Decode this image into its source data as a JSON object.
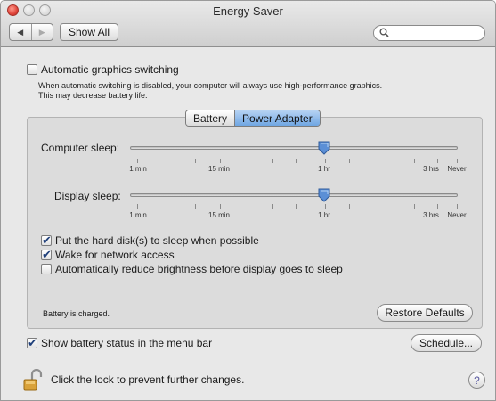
{
  "window": {
    "title": "Energy Saver",
    "show_all_label": "Show All",
    "search_placeholder": "",
    "back_glyph": "◀",
    "forward_glyph": "▶"
  },
  "graphics_switching": {
    "label": "Automatic graphics switching",
    "checked": false,
    "description_line1": "When automatic switching is disabled, your computer will always use high-performance graphics.",
    "description_line2": "This may decrease battery life."
  },
  "tabs": [
    {
      "label": "Battery",
      "active": false
    },
    {
      "label": "Power Adapter",
      "active": true
    }
  ],
  "sliders": {
    "computer_sleep": {
      "label": "Computer sleep:",
      "value": "1 hr",
      "scale_labels": [
        "1 min",
        "15 min",
        "1 hr",
        "3 hrs",
        "Never"
      ]
    },
    "display_sleep": {
      "label": "Display sleep:",
      "value": "1 hr",
      "scale_labels": [
        "1 min",
        "15 min",
        "1 hr",
        "3 hrs",
        "Never"
      ]
    }
  },
  "options": [
    {
      "label": "Put the hard disk(s) to sleep when possible",
      "checked": true
    },
    {
      "label": "Wake for network access",
      "checked": true
    },
    {
      "label": "Automatically reduce brightness before display goes to sleep",
      "checked": false
    }
  ],
  "battery_status": "Battery is charged.",
  "restore_defaults_label": "Restore Defaults",
  "show_battery_status": {
    "label": "Show battery status in the menu bar",
    "checked": true
  },
  "schedule_label": "Schedule...",
  "lock_text": "Click the lock to prevent further changes.",
  "help_glyph": "?",
  "icons": {
    "search": "search-icon",
    "lock": "lock-open-icon",
    "help": "help-icon",
    "slider_thumb": "slider-thumb-icon"
  },
  "colors": {
    "accent": "#6fa6e3",
    "thumb": "#5b8fd6",
    "close_button": "#e0443a"
  }
}
